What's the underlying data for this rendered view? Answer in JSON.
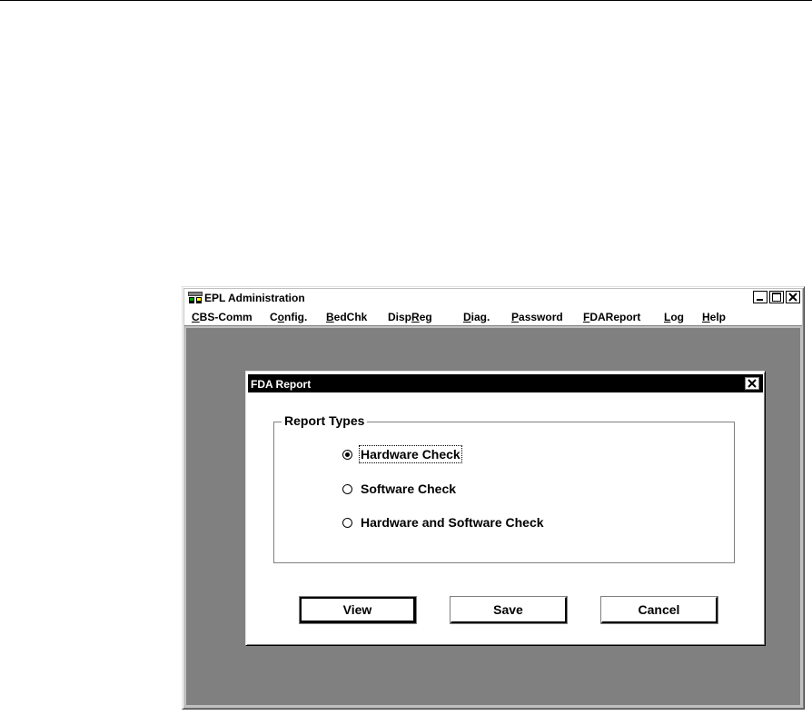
{
  "app": {
    "title": "EPL Administration"
  },
  "menubar": {
    "items": [
      {
        "pre": "",
        "accel": "C",
        "post": "BS-Comm"
      },
      {
        "pre": "C",
        "accel": "o",
        "post": "nfig."
      },
      {
        "pre": "",
        "accel": "B",
        "post": "edChk"
      },
      {
        "pre": "Disp",
        "accel": "R",
        "post": "eg"
      },
      {
        "pre": "",
        "accel": "D",
        "post": "iag."
      },
      {
        "pre": "",
        "accel": "P",
        "post": "assword"
      },
      {
        "pre": "",
        "accel": "F",
        "post": "DAReport"
      },
      {
        "pre": "",
        "accel": "L",
        "post": "og"
      },
      {
        "pre": "",
        "accel": "H",
        "post": "elp"
      }
    ]
  },
  "dialog": {
    "title": "FDA Report",
    "group_label": "Report Types",
    "options": [
      {
        "label": "Hardware Check",
        "selected": true
      },
      {
        "label": "Software Check",
        "selected": false
      },
      {
        "label": "Hardware and Software Check",
        "selected": false
      }
    ],
    "buttons": {
      "view": "View",
      "save": "Save",
      "cancel": "Cancel"
    }
  },
  "icons": {
    "app_icon": "epl-app-icon",
    "minimize": "minimize-icon",
    "maximize": "maximize-icon",
    "close": "close-icon",
    "dialog_close": "close-icon"
  }
}
